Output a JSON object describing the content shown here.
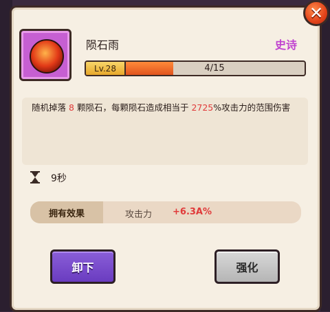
{
  "skill": {
    "name": "陨石雨",
    "rarity": "史诗",
    "rarity_color": "#c043d0",
    "icon": "meteor-skill-icon"
  },
  "level": {
    "badge": "Lv.28",
    "progress_text": "4/15",
    "progress_fraction": 0.267
  },
  "description": {
    "part1": "随机掉落",
    "count": "8",
    "part2": "颗陨石，每颗陨石造成相当于",
    "percent": "2725",
    "part3": "%攻击力的范围伤害"
  },
  "duration": {
    "icon": "hourglass-icon",
    "text": "9秒"
  },
  "effect": {
    "label": "拥有效果",
    "stat": "攻击力",
    "value": "+6.3A%"
  },
  "buttons": {
    "unequip": "卸下",
    "upgrade": "强化"
  },
  "close": {
    "icon": "close-icon",
    "label": "✕"
  },
  "colors": {
    "highlight": "#e03a3a",
    "panel_bg": "#f6efe3",
    "unequip_btn": "#7a4dcc",
    "upgrade_btn": "#c8c8c8"
  }
}
